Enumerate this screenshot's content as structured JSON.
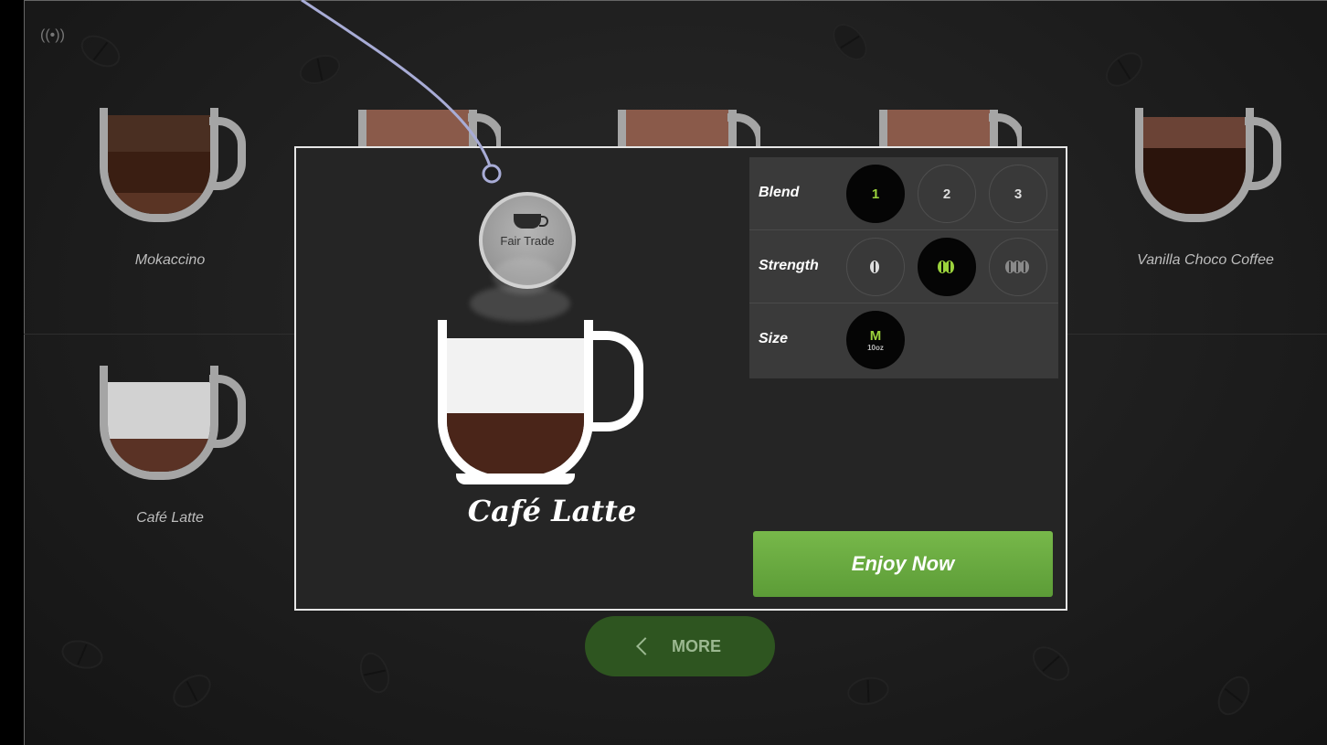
{
  "status": {
    "icon": "wifi-signal-icon"
  },
  "tiles": [
    {
      "label": "Mokaccino"
    },
    {
      "label": "Vanilla Choco Coffee"
    },
    {
      "label": "Café Latte"
    }
  ],
  "more_button": {
    "label": "MORE",
    "icon": "chevron-left-icon"
  },
  "modal": {
    "badge": {
      "label": "Fair Trade",
      "icon": "cup-icon"
    },
    "drink_name": "Café Latte",
    "options": {
      "blend": {
        "label": "Blend",
        "choices": [
          "1",
          "2",
          "3"
        ],
        "selected": "1"
      },
      "strength": {
        "label": "Strength",
        "choices": [
          "1 bean",
          "2 beans",
          "3 beans"
        ],
        "selected": "2 beans"
      },
      "size": {
        "label": "Size",
        "value": "M",
        "sub": "10oz"
      }
    },
    "action": {
      "label": "Enjoy Now"
    }
  },
  "colors": {
    "accent_green": "#9bd23c",
    "button_green": "#6aab40",
    "panel": "#252525",
    "background": "#1e1e1e"
  }
}
